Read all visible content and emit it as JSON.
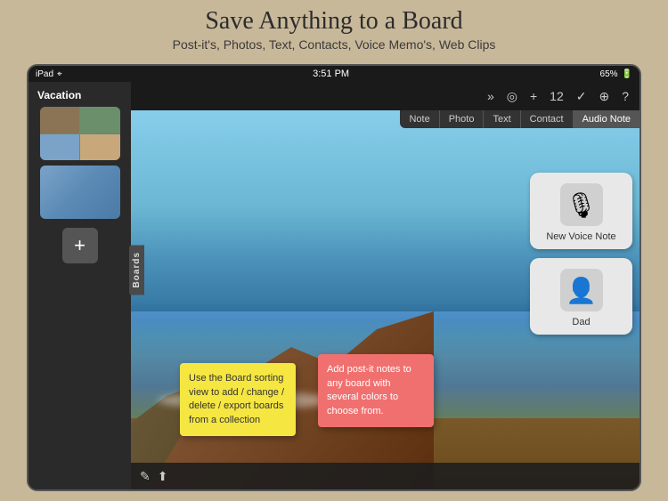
{
  "page": {
    "title": "Save Anything to a Board",
    "subtitle": "Post-it's, Photos, Text, Contacts, Voice Memo's, Web Clips"
  },
  "status_bar": {
    "device": "iPad",
    "wifi": "WiFi",
    "time": "3:51 PM",
    "battery": "65%",
    "battery_charging": true
  },
  "sidebar": {
    "label": "Boards",
    "board_name": "Vacation",
    "add_button": "+"
  },
  "toolbar": {
    "icons": [
      "»",
      "◎",
      "+",
      "12",
      "✓",
      "⊕",
      "?"
    ]
  },
  "content_tabs": [
    {
      "label": "Note",
      "active": false
    },
    {
      "label": "Photo",
      "active": false
    },
    {
      "label": "Text",
      "active": false
    },
    {
      "label": "Contact",
      "active": false
    },
    {
      "label": "Audio Note",
      "active": true
    }
  ],
  "sticky_notes": [
    {
      "id": "yellow",
      "color": "yellow",
      "text": "Use the Board sorting view to add / change / delete / export boards from a collection"
    },
    {
      "id": "pink",
      "color": "pink",
      "text": "Add post-it notes to any board with several colors to choose from."
    }
  ],
  "action_cards": [
    {
      "id": "voice-note",
      "icon": "🎙",
      "label": "New Voice Note"
    },
    {
      "id": "contact",
      "icon": "👤",
      "label": "Dad"
    }
  ],
  "bottom_bar": {
    "icons": [
      "✎",
      "⬆"
    ]
  }
}
